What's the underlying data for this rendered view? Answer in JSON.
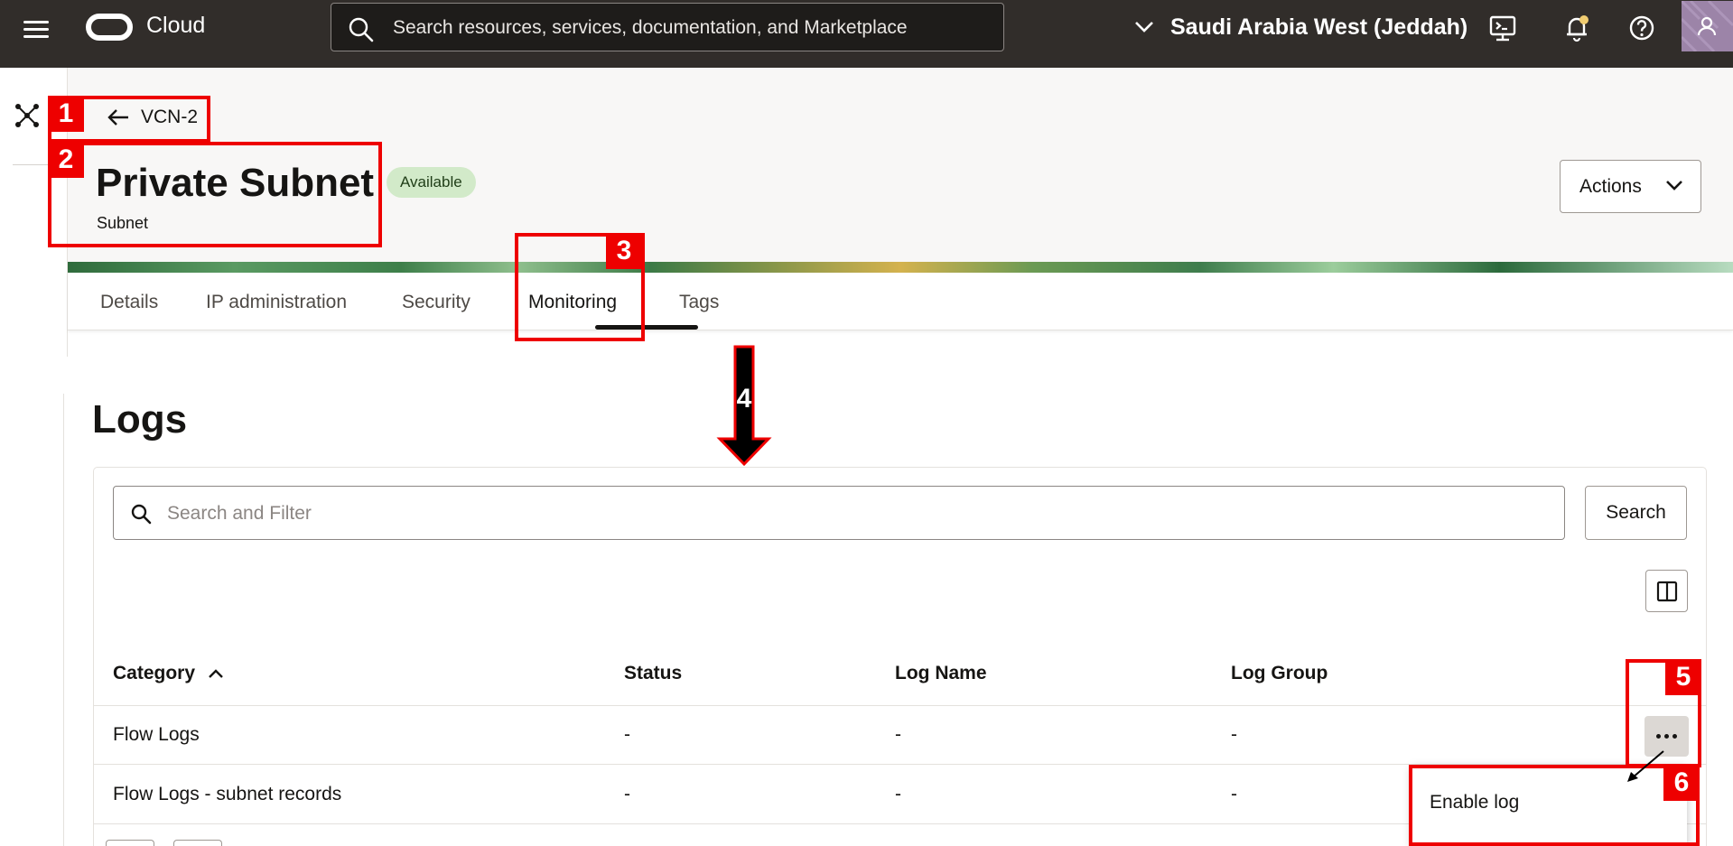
{
  "topbar": {
    "brand": "Cloud",
    "search_placeholder": "Search resources, services, documentation, and Marketplace",
    "region": "Saudi Arabia West (Jeddah)",
    "icons": [
      "menu-icon",
      "oracle-logo",
      "search-icon",
      "chevron-down-icon",
      "cloud-shell-icon",
      "bell-icon",
      "help-icon",
      "user-icon"
    ],
    "colors": {
      "bar": "#312d2a",
      "notification_dot": "#f0cc71"
    }
  },
  "header": {
    "back_label": "VCN-2",
    "title": "Private Subnet",
    "subtitle": "Subnet",
    "status": "Available",
    "actions_label": "Actions"
  },
  "tabs": [
    {
      "label": "Details"
    },
    {
      "label": "IP administration"
    },
    {
      "label": "Security"
    },
    {
      "label": "Monitoring",
      "active": true
    },
    {
      "label": "Tags"
    }
  ],
  "logs": {
    "title": "Logs",
    "filter_placeholder": "Search and Filter",
    "search_label": "Search",
    "columns": [
      "Category",
      "Status",
      "Log Name",
      "Log Group"
    ],
    "sort": {
      "column": "Category",
      "direction": "ascending"
    },
    "rows": [
      {
        "category": "Flow Logs",
        "status": "-",
        "log_name": "-",
        "log_group": "-"
      },
      {
        "category": "Flow Logs - subnet records",
        "status": "-",
        "log_name": "-",
        "log_group": "-"
      }
    ],
    "row_menu": {
      "items": [
        "Enable log"
      ]
    }
  },
  "annotations": {
    "labels": [
      "1",
      "2",
      "3",
      "4",
      "5",
      "6"
    ],
    "color": "#ee0000"
  }
}
